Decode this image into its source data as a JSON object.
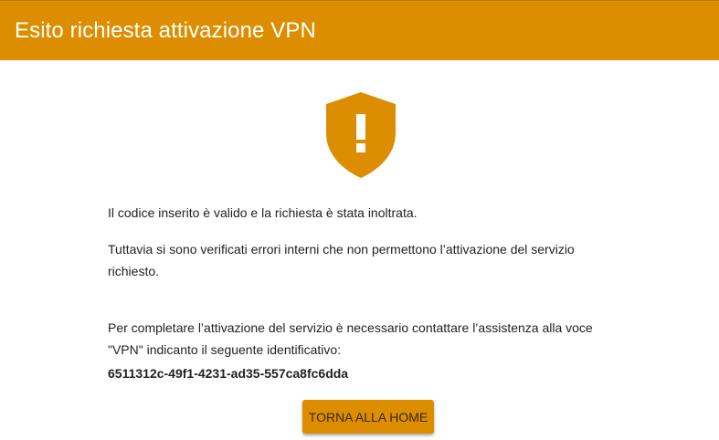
{
  "header": {
    "title": "Esito richiesta attivazione VPN"
  },
  "icon": {
    "name": "shield-warning-icon",
    "color": "#dd8e00"
  },
  "message": {
    "line1": "Il codice inserito è valido e la richiesta è stata inoltrata.",
    "line2": "Tuttavia si sono verificati errori interni che non permettono l’attivazione del servizio richiesto.",
    "line3": "Per completare l’attivazione del servizio è necessario contattare l’assistenza alla voce \"VPN\" indicanto il seguente identificativo:",
    "identifier": "6511312c-49f1-4231-ad35-557ca8fc6dda"
  },
  "actions": {
    "home_label": "TORNA ALLA HOME"
  },
  "colors": {
    "accent": "#dd8e00",
    "header_text": "#ffffff",
    "body_text": "#222222"
  }
}
